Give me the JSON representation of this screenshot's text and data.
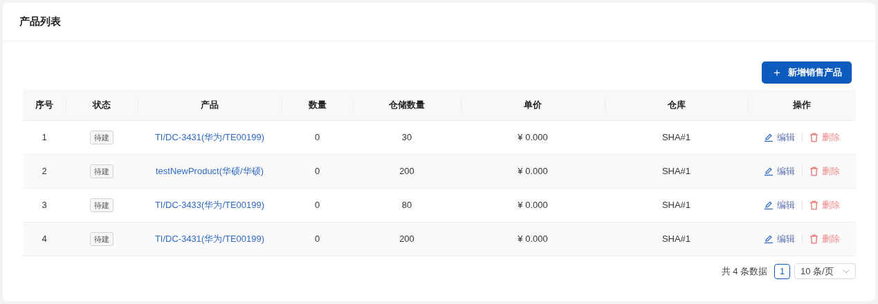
{
  "title": "产品列表",
  "add_button": {
    "icon": "＋",
    "label": "新增销售产品"
  },
  "table": {
    "columns": [
      "序号",
      "状态",
      "产品",
      "数量",
      "仓储数量",
      "单价",
      "仓库",
      "操作"
    ],
    "rows": [
      {
        "index": "1",
        "status": "待建",
        "product": "TI/DC-3431(华为/TE00199)",
        "quantity": "0",
        "stock": "30",
        "price": "¥ 0.000",
        "warehouse": "SHA#1",
        "edit": "编辑",
        "delete": "删除"
      },
      {
        "index": "2",
        "status": "待建",
        "product": "testNewProduct(华硕/华硕)",
        "quantity": "0",
        "stock": "200",
        "price": "¥ 0.000",
        "warehouse": "SHA#1",
        "edit": "编辑",
        "delete": "删除"
      },
      {
        "index": "3",
        "status": "待建",
        "product": "TI/DC-3433(华为/TE00199)",
        "quantity": "0",
        "stock": "80",
        "price": "¥ 0.000",
        "warehouse": "SHA#1",
        "edit": "编辑",
        "delete": "删除"
      },
      {
        "index": "4",
        "status": "待建",
        "product": "TI/DC-3431(华为/TE00199)",
        "quantity": "0",
        "stock": "200",
        "price": "¥ 0.000",
        "warehouse": "SHA#1",
        "edit": "编辑",
        "delete": "删除"
      }
    ]
  },
  "pagination": {
    "total": "共 4 条数据",
    "pages": [
      {
        "label": "1",
        "selected": true
      }
    ],
    "page_size": "10 条/页"
  }
}
